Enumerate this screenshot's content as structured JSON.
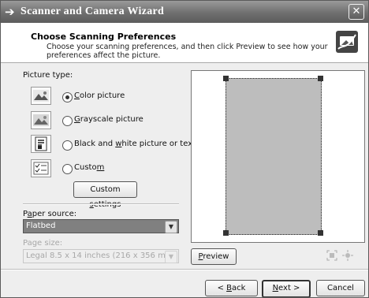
{
  "window": {
    "title": "Scanner and Camera Wizard",
    "close_glyph": "✕"
  },
  "header": {
    "title": "Choose Scanning Preferences",
    "subtitle": "Choose your scanning preferences, and then click Preview to see how your preferences affect the picture."
  },
  "picture_type": {
    "label": "Picture type:",
    "options": [
      {
        "pre": "",
        "key": "C",
        "post": "olor picture",
        "selected": true,
        "icon": "color-picture-icon"
      },
      {
        "pre": "",
        "key": "G",
        "post": "rayscale picture",
        "selected": false,
        "icon": "grayscale-picture-icon"
      },
      {
        "pre": "Black and ",
        "key": "w",
        "post": "hite picture or text",
        "selected": false,
        "icon": "black-white-picture-icon"
      },
      {
        "pre": "Custo",
        "key": "m",
        "post": "",
        "selected": false,
        "icon": "custom-picture-icon"
      }
    ],
    "custom_settings": {
      "pre": "Custom ",
      "key": "s",
      "post": "ettings"
    }
  },
  "paper_source": {
    "label_pre": "P",
    "label_key": "a",
    "label_post": "per source:",
    "value": "Flatbed"
  },
  "page_size": {
    "label": "Page size:",
    "value": "Legal 8.5 x 14 inches (216 x 356 mm)",
    "disabled": true
  },
  "preview": {
    "button": {
      "pre": "",
      "key": "P",
      "post": "review"
    },
    "tools": [
      "fit-to-selection-icon",
      "zoom-icon"
    ]
  },
  "nav": {
    "back": {
      "pre": "< ",
      "key": "B",
      "post": "ack"
    },
    "next": {
      "pre": "",
      "key": "N",
      "post": "ext >"
    },
    "cancel": "Cancel"
  },
  "colors": {
    "title_bar": "#6f6f6f",
    "dialog_bg": "#eeeeee",
    "select_highlight": "#808080",
    "disabled_text": "#a8a8a8",
    "preview_area": "#bdbdbd"
  }
}
